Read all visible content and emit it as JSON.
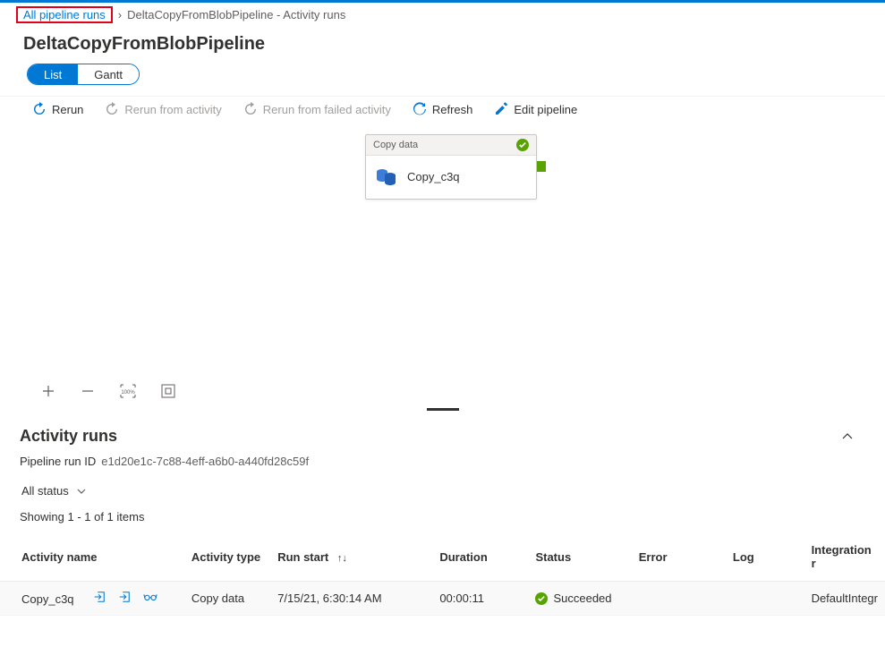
{
  "breadcrumb": {
    "link": "All pipeline runs",
    "current": "DeltaCopyFromBlobPipeline - Activity runs"
  },
  "page_title": "DeltaCopyFromBlobPipeline",
  "view_toggle": {
    "list": "List",
    "gantt": "Gantt"
  },
  "toolbar": {
    "rerun": "Rerun",
    "rerun_from_activity": "Rerun from activity",
    "rerun_from_failed": "Rerun from failed activity",
    "refresh": "Refresh",
    "edit_pipeline": "Edit pipeline"
  },
  "activity_card": {
    "header": "Copy data",
    "name": "Copy_c3q"
  },
  "zoom": {
    "reset_label": "100%"
  },
  "activity_runs": {
    "title": "Activity runs",
    "run_id_label": "Pipeline run ID",
    "run_id_value": "e1d20e1c-7c88-4eff-a6b0-a440fd28c59f",
    "filter": "All status",
    "count_text": "Showing 1 - 1 of 1 items",
    "columns": {
      "activity_name": "Activity name",
      "activity_type": "Activity type",
      "run_start": "Run start",
      "duration": "Duration",
      "status": "Status",
      "error": "Error",
      "log": "Log",
      "integration": "Integration r"
    },
    "rows": [
      {
        "activity_name": "Copy_c3q",
        "activity_type": "Copy data",
        "run_start": "7/15/21, 6:30:14 AM",
        "duration": "00:00:11",
        "status": "Succeeded",
        "error": "",
        "log": "",
        "integration": "DefaultIntegr"
      }
    ]
  }
}
